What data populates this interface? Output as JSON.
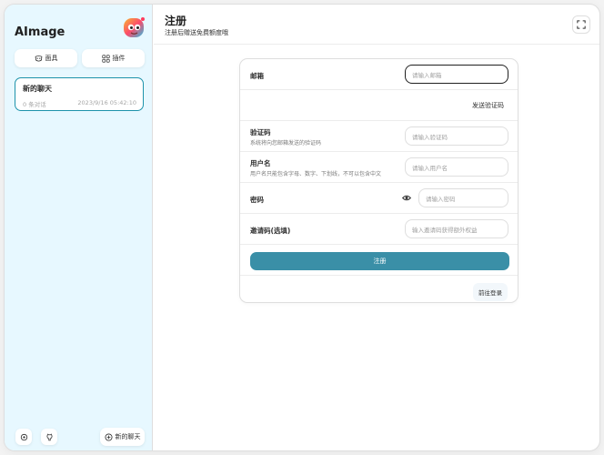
{
  "sidebar": {
    "app_title": "AImage",
    "mask_button": "面具",
    "plugin_button": "插件",
    "chats": [
      {
        "title": "新的聊天",
        "count": "0 条对话",
        "time": "2023/9/16 05:42:10"
      }
    ],
    "new_chat_button": "新的聊天"
  },
  "header": {
    "title": "注册",
    "subtitle": "注册后赠送免费额度哦"
  },
  "form": {
    "email": {
      "label": "邮箱",
      "placeholder": "请输入邮箱"
    },
    "send_code": "发送验证码",
    "code": {
      "label": "验证码",
      "desc": "系统将向您邮箱发送的验证码",
      "placeholder": "请输入验证码"
    },
    "username": {
      "label": "用户名",
      "desc": "用户名只能包含字母、数字、下划线，不可以包含中文",
      "placeholder": "请输入用户名"
    },
    "password": {
      "label": "密码",
      "placeholder": "请输入密码"
    },
    "invite": {
      "label": "邀请码(选填)",
      "placeholder": "输入邀请码获得额外权益"
    },
    "submit": "注册",
    "login": "前往登录"
  },
  "colors": {
    "accent": "#1d93ab",
    "button": "#3a8fa7",
    "sidebar_bg": "#e7f8ff"
  },
  "icons": [
    "mask-icon",
    "plugin-icon",
    "settings-icon",
    "github-icon",
    "add-icon",
    "fullscreen-icon",
    "eye-icon"
  ]
}
